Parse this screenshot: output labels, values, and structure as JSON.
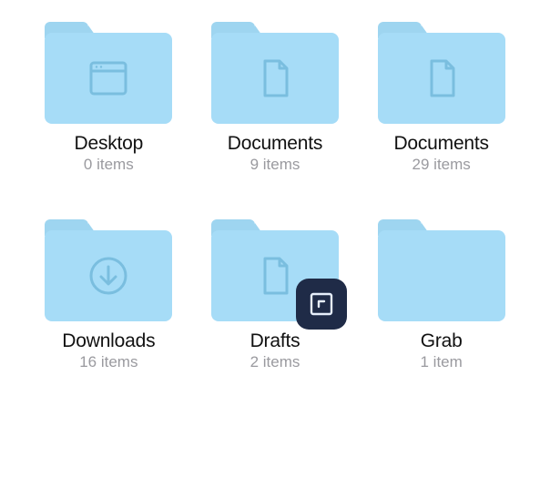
{
  "colors": {
    "folder_body": "#a6dcf7",
    "folder_tab": "#9ed5f0",
    "icon_stroke": "#7ec0e0",
    "text_primary": "#111111",
    "text_secondary": "#9a9a9f",
    "badge_bg": "#1f2b47"
  },
  "folders": [
    {
      "name": "Desktop",
      "count": "0 items",
      "icon": "window-icon",
      "has_app_badge": false
    },
    {
      "name": "Documents",
      "count": "9 items",
      "icon": "document-icon",
      "has_app_badge": false
    },
    {
      "name": "Documents",
      "count": "29 items",
      "icon": "document-icon",
      "has_app_badge": false
    },
    {
      "name": "Downloads",
      "count": "16 items",
      "icon": "download-icon",
      "has_app_badge": false
    },
    {
      "name": "Drafts",
      "count": "2 items",
      "icon": "document-icon",
      "has_app_badge": true
    },
    {
      "name": "Grab",
      "count": "1 item",
      "icon": "none",
      "has_app_badge": false
    }
  ]
}
